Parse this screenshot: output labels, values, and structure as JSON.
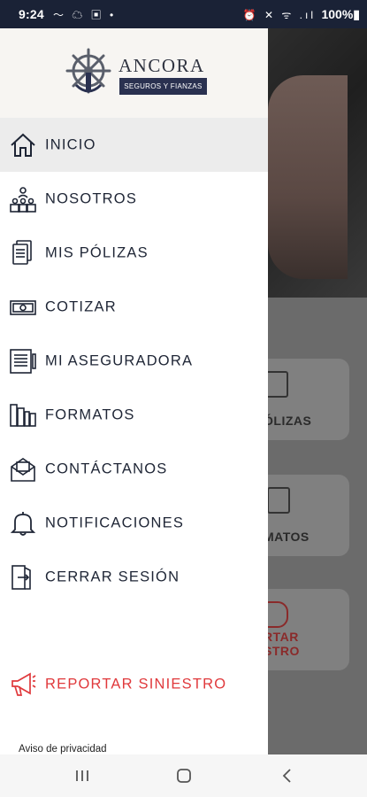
{
  "status_bar": {
    "time": "9:24",
    "left_icons": "〜 ☁ ▣ •",
    "right_icons": "⏰ ✕ ᯤ .ıl",
    "battery": "100%▮"
  },
  "logo": {
    "name": "ANCORA",
    "tagline": "SEGUROS Y FIANZAS"
  },
  "menu": {
    "items": [
      {
        "label": "INICIO",
        "icon": "home-icon",
        "active": true
      },
      {
        "label": "NOSOTROS",
        "icon": "team-icon"
      },
      {
        "label": "MIS PÓLIZAS",
        "icon": "documents-icon"
      },
      {
        "label": "COTIZAR",
        "icon": "money-icon"
      },
      {
        "label": "MI ASEGURADORA",
        "icon": "newspaper-icon"
      },
      {
        "label": "FORMATOS",
        "icon": "books-icon"
      },
      {
        "label": "CONTÁCTANOS",
        "icon": "mail-icon"
      },
      {
        "label": "NOTIFICACIONES",
        "icon": "bell-icon"
      },
      {
        "label": "CERRAR SESIÓN",
        "icon": "logout-icon"
      }
    ],
    "report": {
      "label": "REPORTAR SINIESTRO",
      "icon": "megaphone-icon",
      "color": "#e0393c"
    }
  },
  "privacy_link": "Aviso de privacidad",
  "background": {
    "cards": [
      "ÓLIZAS",
      "MATOS",
      "RTAR\nSTRO"
    ]
  },
  "colors": {
    "brand_navy": "#2a3150",
    "accent_red": "#e0393c",
    "text_dark": "#1e2535"
  }
}
